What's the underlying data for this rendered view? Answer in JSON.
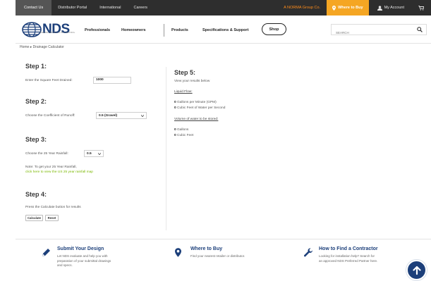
{
  "topbar": {
    "contact": "Contact Us",
    "distributor": "Distributor Portal",
    "international": "International",
    "careers": "Careers",
    "group": "A NORMA Group Co.",
    "where_to_buy": "Where to Buy",
    "account": "My Account"
  },
  "header": {
    "logo_text": "NDS",
    "logo_tagline": "WHERE WATER IS IN CONTROL",
    "nav": [
      "Professionals",
      "Homeowners",
      "Products",
      "Specifications & Support"
    ],
    "shop": "Shop",
    "search_placeholder": "SEARCH"
  },
  "breadcrumb": "Home ▸ Drainage Calculator",
  "calculator": {
    "step1": {
      "title": "Step 1:",
      "label": "Enter the Square Feet Drained:",
      "value": "1000"
    },
    "step2": {
      "title": "Step 2:",
      "label": "Choose the Coefficient of Runoff:",
      "value": "0.5 (Gravel)"
    },
    "step3": {
      "title": "Step 3:",
      "label": "Choose the 25 Year Rainfall:",
      "value": "0.5",
      "note": "Note: To get your 25 Year Rainfall,",
      "link": "click here to view the US 25 year rainfall map"
    },
    "step4": {
      "title": "Step 4:",
      "label": "Press the Calculate button for results",
      "calculate": "Calculate",
      "reset": "Reset"
    },
    "step5": {
      "title": "Step 5:",
      "label": "View your results below",
      "liquid_flow": "Liquid Flow:",
      "gpm_value": "0",
      "gpm_label": "Gallons per Minute (GPM)",
      "cfs_value": "0",
      "cfs_label": "Cubic Feet of Water per Second",
      "volume_title": "Volume of water to be stored:",
      "gal_value": "0",
      "gal_label": "Gallons",
      "cuft_value": "0",
      "cuft_label": "Cubic Feet"
    }
  },
  "features": [
    {
      "title": "Submit Your Design",
      "desc1": "Let NDS evaluate and help you with",
      "desc2": "preparation of your submittal drawings",
      "desc3": "and specs."
    },
    {
      "title": "Where to Buy",
      "desc1": "Find your nearest retailer or distributor.",
      "desc2": "",
      "desc3": ""
    },
    {
      "title": "How to Find a Contractor",
      "desc1": "Looking for installation help? Search for",
      "desc2": "an approved NDS Preferred Partner here.",
      "desc3": ""
    }
  ],
  "colors": {
    "brand_blue": "#1c3f7a",
    "orange": "#f5a623",
    "link_green": "#7ab800",
    "topbar_bg": "#2e2e2e"
  }
}
